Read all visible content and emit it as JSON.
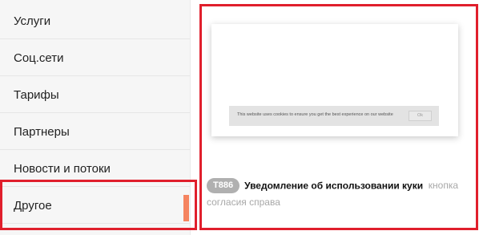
{
  "sidebar": {
    "items": [
      {
        "label": "Услуги"
      },
      {
        "label": "Соц.сети"
      },
      {
        "label": "Тарифы"
      },
      {
        "label": "Партнеры"
      },
      {
        "label": "Новости и потоки"
      },
      {
        "label": "Другое"
      }
    ],
    "active_index": 5,
    "accent_color": "#f58460"
  },
  "preview": {
    "cookie_text": "This website uses cookies to ensure you get the best experience on our website",
    "ok_label": "Ok"
  },
  "item": {
    "badge": "T886",
    "title": "Уведомление об использовании куки",
    "description": "кнопка согласия справа"
  },
  "highlight_color": "#e01f2c"
}
